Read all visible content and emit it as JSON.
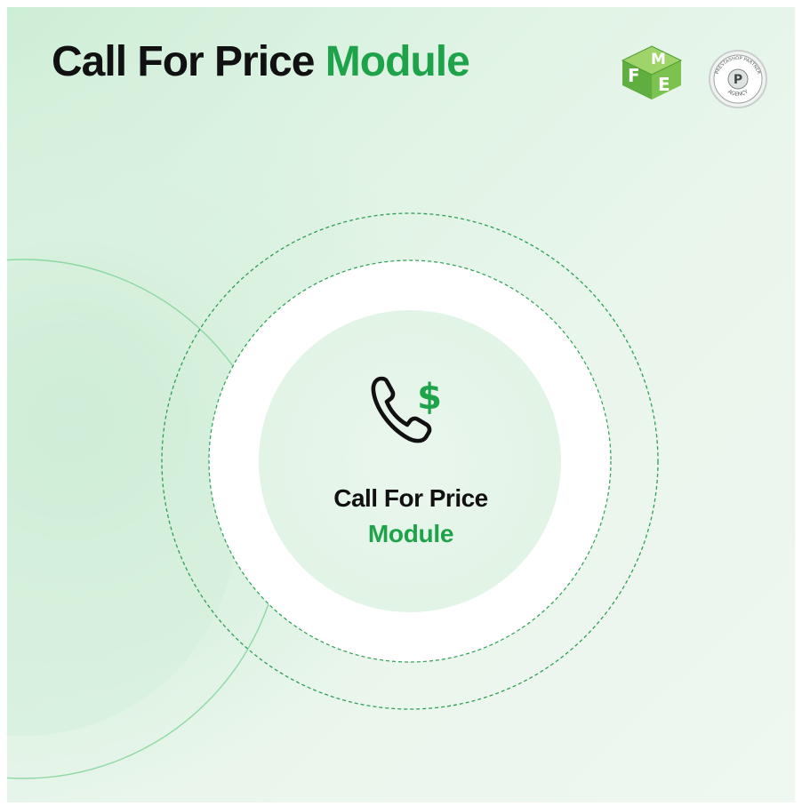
{
  "header": {
    "title_dark": "Call For Price",
    "title_green": "Module"
  },
  "logos": {
    "fme": {
      "icon": "fme-cube-logo-icon",
      "letters": [
        "F",
        "M",
        "E"
      ]
    },
    "partner_badge": {
      "icon": "prestashop-partner-agency-badge-icon",
      "ring_text_top": "PRESTASHOP PARTNER",
      "ring_text_bottom": "AGENCY",
      "monogram": "P"
    }
  },
  "center": {
    "icon": "phone-dollar-icon",
    "dollar_symbol": "$",
    "title": "Call For Price",
    "subtitle": "Module"
  },
  "colors": {
    "accent_green": "#1fa34a",
    "text_dark": "#111111",
    "background_mint": "#dff3e4"
  }
}
